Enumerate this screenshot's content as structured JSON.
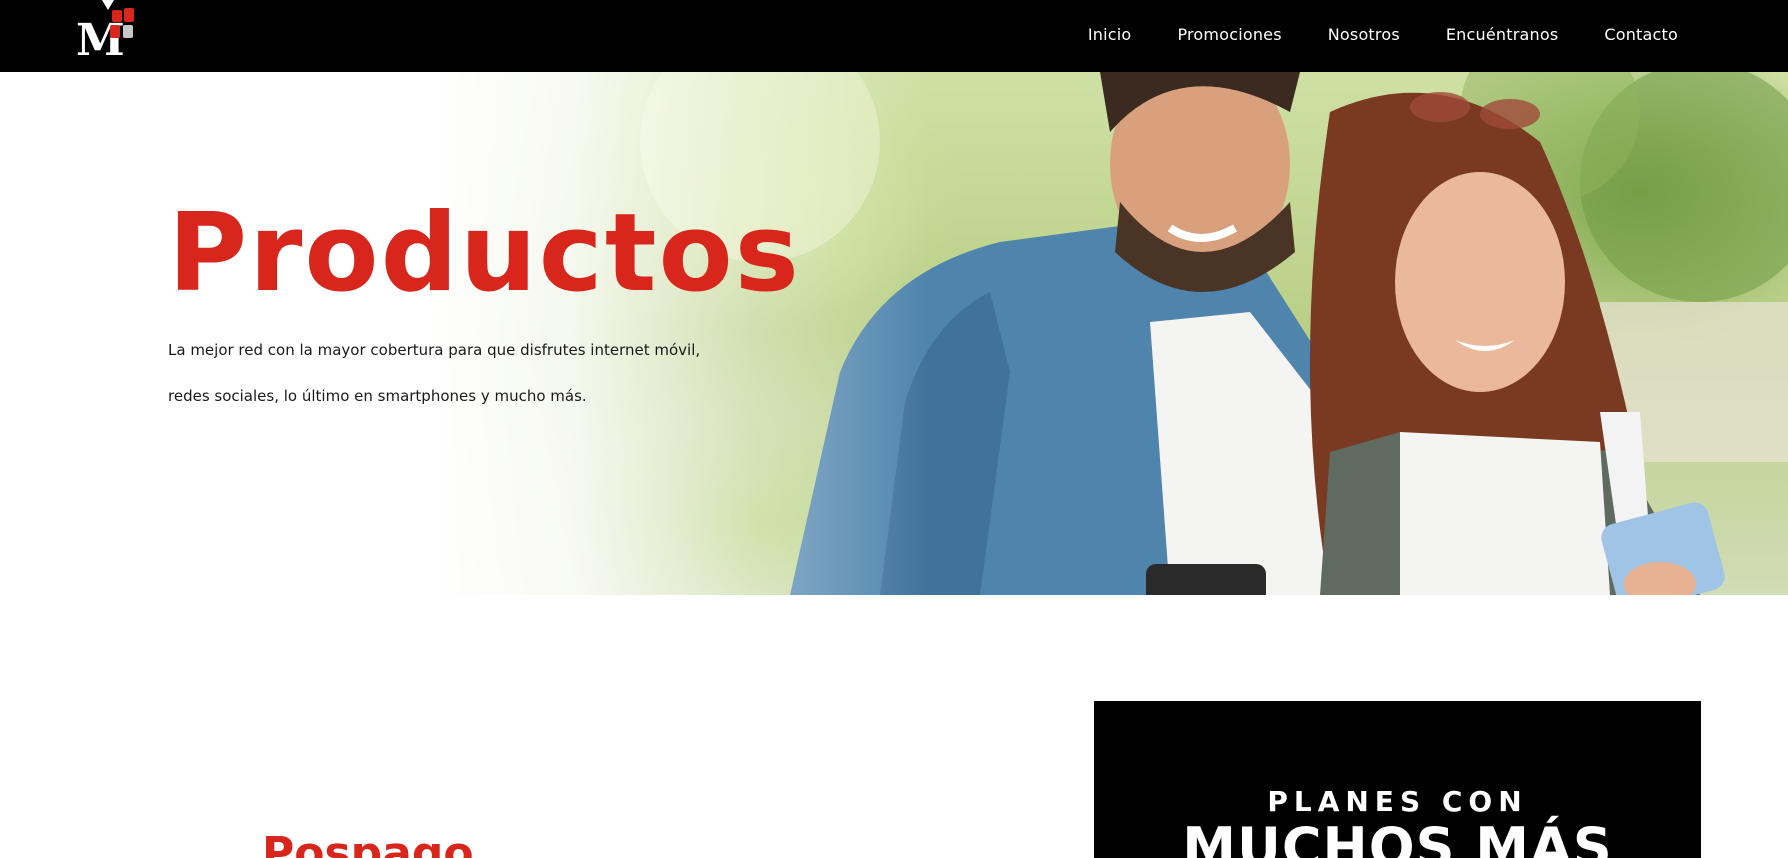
{
  "brand": {
    "logo_letter": "M",
    "accent_color": "#d8261c"
  },
  "nav": {
    "items": [
      {
        "label": "Inicio"
      },
      {
        "label": "Promociones"
      },
      {
        "label": "Nosotros"
      },
      {
        "label": "Encuéntranos"
      },
      {
        "label": "Contacto"
      }
    ]
  },
  "hero": {
    "title": "Productos",
    "description_line1": "La mejor red con la mayor cobertura para que disfrutes internet móvil,",
    "description_line2": "redes sociales, lo último en smartphones y mucho más."
  },
  "section": {
    "title": "Pospago"
  },
  "promo": {
    "line1": "PLANES CON",
    "line2": "MUCHOS MÁS"
  }
}
